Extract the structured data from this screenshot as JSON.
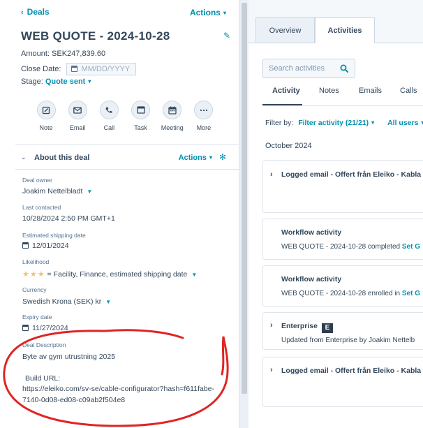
{
  "header": {
    "back_label": "Deals",
    "actions_label": "Actions",
    "title": "WEB QUOTE - 2024-10-28"
  },
  "summary": {
    "amount": "Amount: SEK247,839.60",
    "close_date_label": "Close Date:",
    "close_date_placeholder": "MM/DD/YYYY",
    "stage_label": "Stage:",
    "stage_value": "Quote sent"
  },
  "quick_actions": [
    {
      "label": "Note",
      "icon": "note-icon"
    },
    {
      "label": "Email",
      "icon": "email-icon"
    },
    {
      "label": "Call",
      "icon": "call-icon"
    },
    {
      "label": "Task",
      "icon": "task-icon"
    },
    {
      "label": "Meeting",
      "icon": "meeting-icon"
    },
    {
      "label": "More",
      "icon": "more-icon"
    }
  ],
  "about": {
    "title": "About this deal",
    "actions_label": "Actions",
    "fields": {
      "deal_owner": {
        "label": "Deal owner",
        "value": "Joakim Nettelbladt"
      },
      "last_contacted": {
        "label": "Last contacted",
        "value": "10/28/2024 2:50 PM GMT+1"
      },
      "estimated_shipping": {
        "label": "Estimated shipping date",
        "value": "12/01/2024"
      },
      "likelihood": {
        "label": "Likelihood",
        "stars": "★★★",
        "value": "= Facility, Finance, estimated shipping date"
      },
      "currency": {
        "label": "Currency",
        "value": "Swedish Krona (SEK) kr"
      },
      "expiry": {
        "label": "Expiry date",
        "value": "11/27/2024"
      },
      "description": {
        "label": "Deal Description",
        "line1": "Byte av gym utrustning 2025",
        "line2": "Build URL:",
        "line3": "https://eleiko.com/sv-se/cable-configurator?hash=f611fabe-",
        "line4": "7140-0d08-ed08-c09ab2f504e8"
      }
    }
  },
  "right_panel": {
    "tabs": {
      "overview": "Overview",
      "activities": "Activities"
    },
    "search_placeholder": "Search activities",
    "sub_tabs": [
      "Activity",
      "Notes",
      "Emails",
      "Calls"
    ],
    "filter_by_label": "Filter by:",
    "filter_activity": "Filter activity (21/21)",
    "all_users": "All users",
    "month": "October 2024",
    "cards": [
      {
        "title": "Logged email - Offert från Eleiko - Kabla"
      },
      {
        "title": "Workflow activity",
        "text": "WEB QUOTE - 2024-10-28 completed",
        "link": "Set G"
      },
      {
        "title": "Workflow activity",
        "text": "WEB QUOTE - 2024-10-28 enrolled in",
        "link": "Set G"
      },
      {
        "title": "Enterprise",
        "badge": "E",
        "text": "Updated from Enterprise by Joakim Nettelb"
      },
      {
        "title": "Logged email - Offert från Eleiko - Kabla"
      }
    ]
  }
}
